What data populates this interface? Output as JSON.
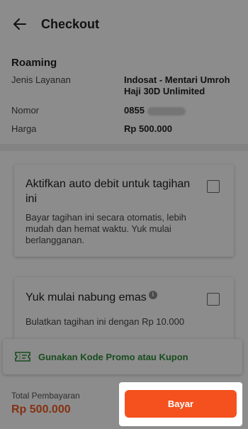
{
  "header": {
    "title": "Checkout",
    "back_icon": "arrow-left-icon"
  },
  "service": {
    "heading": "Roaming",
    "rows": [
      {
        "label": "Jenis Layanan",
        "value": "Indosat - Mentari Umroh Haji 30D Unlimited"
      },
      {
        "label": "Nomor",
        "value": "0855"
      },
      {
        "label": "Harga",
        "value": "Rp 500.000"
      }
    ]
  },
  "autodebit": {
    "title": "Aktifkan auto debit untuk tagihan ini",
    "description": "Bayar tagihan ini secara otomatis, lebih mudah dan hemat waktu. Yuk mulai berlangganan.",
    "checked": false
  },
  "gold": {
    "title": "Yuk mulai nabung emas",
    "info_icon": "i",
    "description": "Bulatkan tagihan ini dengan Rp 10.000",
    "checked": false
  },
  "promo": {
    "label": "Gunakan Kode Promo atau Kupon",
    "icon": "ticket-icon",
    "color": "#2e8b3a"
  },
  "footer": {
    "total_label": "Total Pembayaran",
    "total_value": "Rp 500.000",
    "pay_label": "Bayar",
    "accent": "#f4511e"
  }
}
